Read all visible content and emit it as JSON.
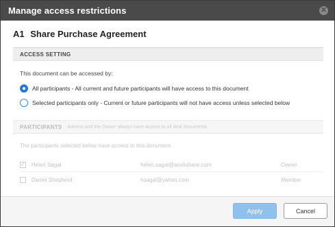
{
  "dialog": {
    "title": "Manage access restrictions",
    "close_icon": "close-icon"
  },
  "document": {
    "number": "A1",
    "name": "Share Purchase Agreement"
  },
  "access_setting": {
    "header": "ACCESS SETTING",
    "intro": "This document can be accessed by:",
    "options": [
      {
        "label": "All participants - All current and future participants will have access to this document",
        "selected": true
      },
      {
        "label": "Selected participants only - Current or future participants will not have access unless selected below",
        "selected": false
      }
    ]
  },
  "participants": {
    "header": "PARTICIPANTS",
    "header_note": "- Admins and the Owner always have access to all deal documents",
    "intro": "The participants selected below have access to this document.",
    "rows": [
      {
        "name": "Helen Sagal",
        "email": "helen.sagal@workshare.com",
        "role": "Owner",
        "checked": true
      },
      {
        "name": "Daniel Shepherd",
        "email": "hsagal@yahoo.com",
        "role": "Member",
        "checked": false
      }
    ]
  },
  "footer": {
    "apply_label": "Apply",
    "cancel_label": "Cancel"
  },
  "colors": {
    "titlebar": "#4a4a4a",
    "accent": "#2b78d0",
    "apply_button": "#8fc1ec"
  }
}
